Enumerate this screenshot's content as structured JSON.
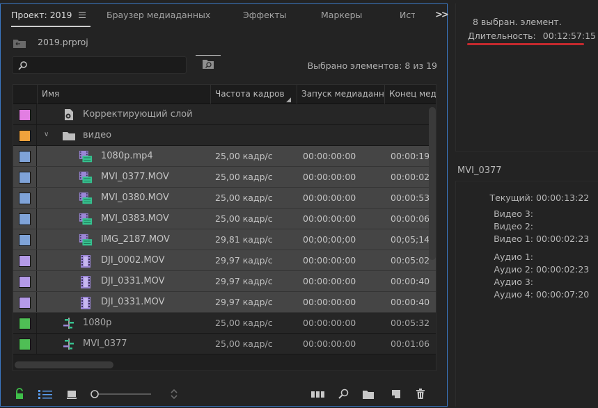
{
  "tabs": {
    "project": "Проект: 2019",
    "media_browser": "Браузер медиаданных",
    "effects": "Эффекты",
    "markers": "Маркеры",
    "more": "Ист"
  },
  "project_file": "2019.prproj",
  "search": {
    "value": "",
    "placeholder": ""
  },
  "selected_count": "Выбрано элементов: 8 из 19",
  "columns": {
    "name": "Имя",
    "fps": "Частота кадров",
    "start": "Запуск медиаданн",
    "end": "Конец мед"
  },
  "rows": [
    {
      "name": "Корректирующий слой",
      "fps": "",
      "start": "",
      "end": "",
      "swatch": "#e27ee2",
      "icon": "adjustment-layer-icon"
    },
    {
      "name": "видео",
      "fps": "",
      "start": "",
      "end": "",
      "swatch": "#f0a23c",
      "icon": "folder-icon"
    },
    {
      "name": "1080p.mp4",
      "fps": "25,00 кадр/с",
      "start": "00:00:00:00",
      "end": "00:00:19",
      "swatch": "#7fa3d8",
      "icon": "video-clip-icon"
    },
    {
      "name": "MVI_0377.MOV",
      "fps": "25,00 кадр/с",
      "start": "00:00:00:00",
      "end": "00:00:02",
      "swatch": "#7fa3d8",
      "icon": "video-clip-icon"
    },
    {
      "name": "MVI_0380.MOV",
      "fps": "25,00 кадр/с",
      "start": "00:00:00:00",
      "end": "00:00:53",
      "swatch": "#7fa3d8",
      "icon": "video-clip-icon"
    },
    {
      "name": "MVI_0383.MOV",
      "fps": "25,00 кадр/с",
      "start": "00:00:00:00",
      "end": "00:00:06",
      "swatch": "#7fa3d8",
      "icon": "video-clip-icon"
    },
    {
      "name": "IMG_2187.MOV",
      "fps": "29,81 кадр/с",
      "start": "00;00;00;00",
      "end": "00;05;14,",
      "swatch": "#7fa3d8",
      "icon": "video-clip-icon"
    },
    {
      "name": "DJI_0002.MOV",
      "fps": "29,97 кадр/с",
      "start": "00:00:00:00",
      "end": "00:05:02",
      "swatch": "#b49ae8",
      "icon": "video-only-clip-icon"
    },
    {
      "name": "DJI_0331.MOV",
      "fps": "29,97 кадр/с",
      "start": "00:00:00:00",
      "end": "00:00:40",
      "swatch": "#b49ae8",
      "icon": "video-only-clip-icon"
    },
    {
      "name": "DJI_0331.MOV",
      "fps": "29,97 кадр/с",
      "start": "00:00:00:00",
      "end": "00:00:40",
      "swatch": "#b49ae8",
      "icon": "video-only-clip-icon"
    },
    {
      "name": "1080p",
      "fps": "25,00 кадр/с",
      "start": "00:00:00:00",
      "end": "00:05:32",
      "swatch": "#4fbf55",
      "icon": "sequence-icon"
    },
    {
      "name": "MVI_0377",
      "fps": "25,00 кадр/с",
      "start": "00:00:00:00",
      "end": "00:01:06",
      "swatch": "#4fbf55",
      "icon": "sequence-icon"
    }
  ],
  "info": {
    "selected": "8 выбран. элемент.",
    "duration_label": "Длительность:",
    "duration_value": "00:12:57:15",
    "clip_name": "MVI_0377",
    "current_label": "Текущий:",
    "current_value": "00:00:13:22",
    "video3_label": "Видео 3:",
    "video3_value": "",
    "video2_label": "Видео 2:",
    "video2_value": "",
    "video1_label": "Видео 1:",
    "video1_value": "00:00:02:23",
    "audio1_label": "Аудио 1:",
    "audio1_value": "",
    "audio2_label": "Аудио 2:",
    "audio2_value": "00:00:02:23",
    "audio3_label": "Аудио 3:",
    "audio3_value": "",
    "audio4_label": "Аудио 4:",
    "audio4_value": "00:00:07:20"
  },
  "colors": {
    "panel_border": "#3b78c4",
    "highlight_underline": "#c42a2e",
    "lock_icon": "#3fbf4a",
    "active_view_icon": "#5a9df0"
  }
}
